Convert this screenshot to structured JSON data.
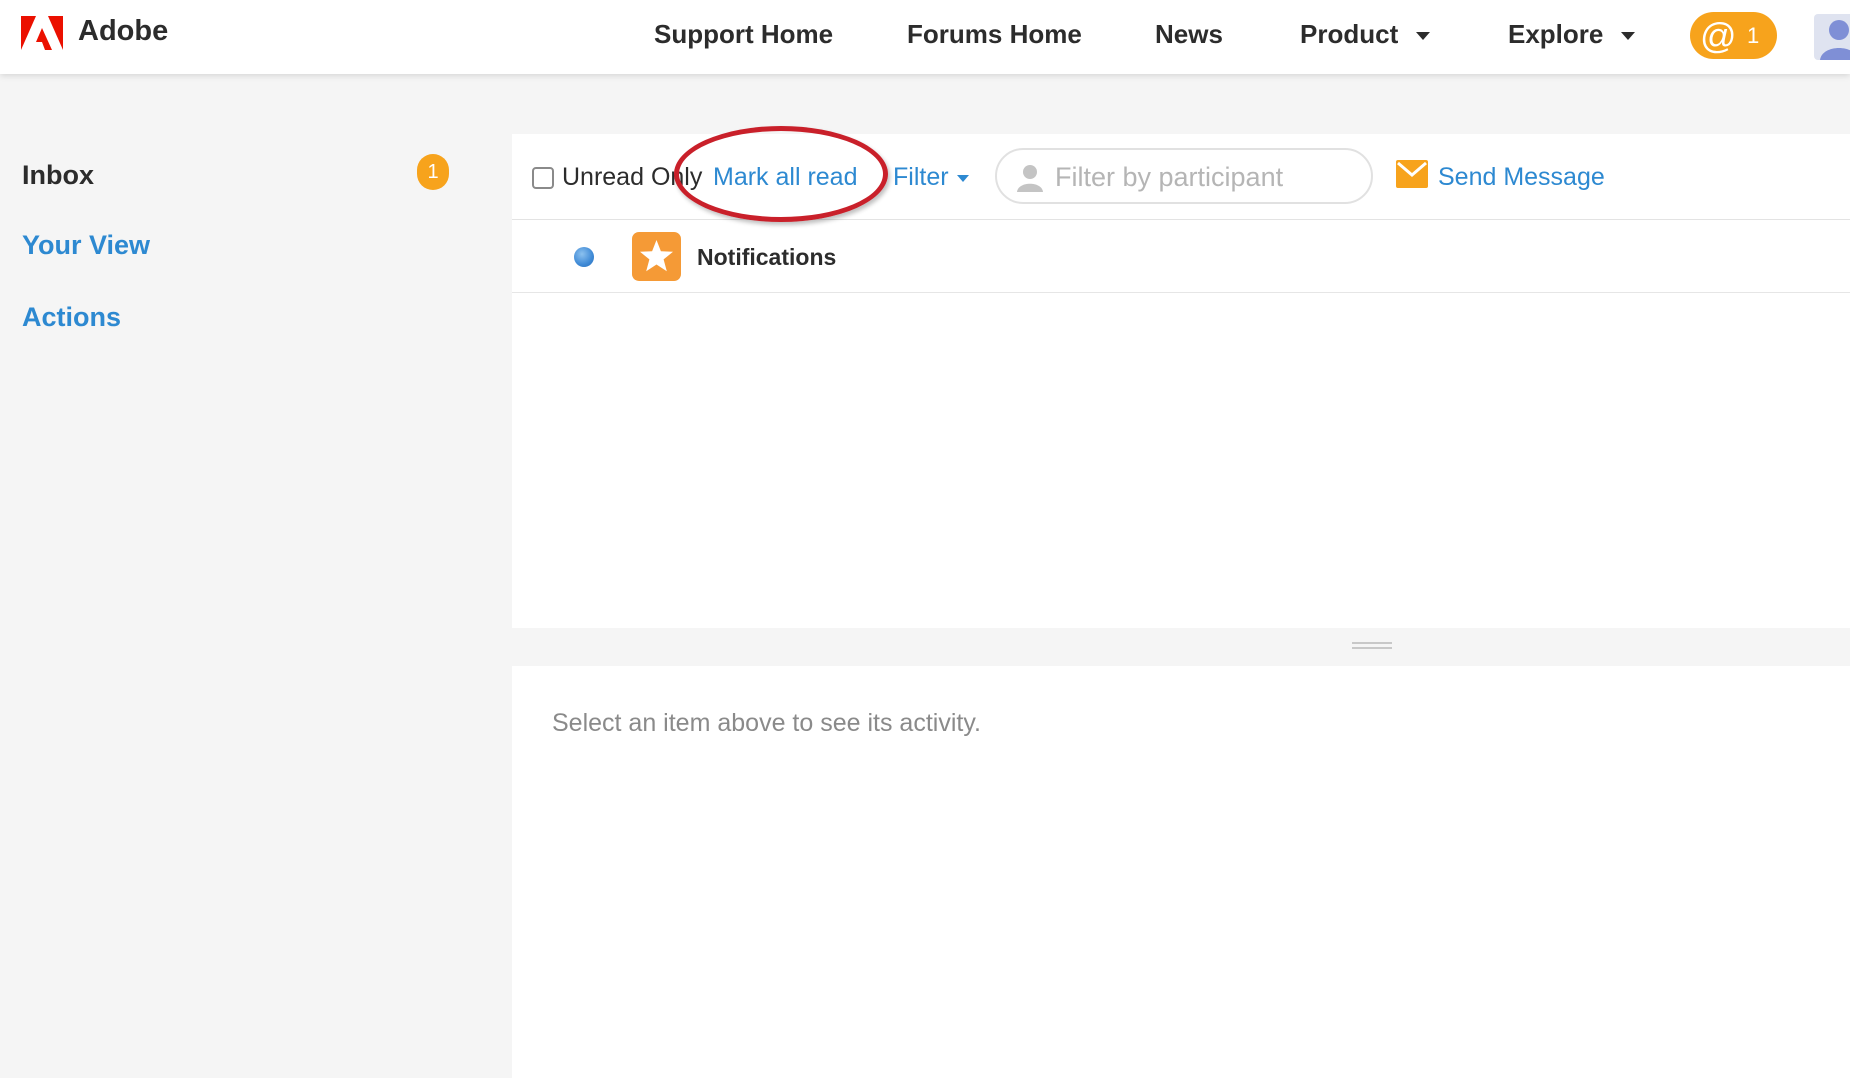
{
  "header": {
    "brand": "Adobe",
    "nav": [
      {
        "label": "Support Home"
      },
      {
        "label": "Forums Home"
      },
      {
        "label": "News"
      },
      {
        "label": "Product"
      },
      {
        "label": "Explore"
      }
    ],
    "mentions": {
      "symbol": "@",
      "count": "1"
    }
  },
  "sidebar": {
    "inbox": {
      "label": "Inbox",
      "badge": "1"
    },
    "items": [
      {
        "label": "Your View"
      },
      {
        "label": "Actions"
      }
    ]
  },
  "toolbar": {
    "unread_only_label": "Unread Only",
    "mark_all_read": "Mark all read",
    "filter": "Filter",
    "participant_placeholder": "Filter by participant",
    "send_message": "Send Message"
  },
  "list": {
    "rows": [
      {
        "title": "Notifications"
      }
    ]
  },
  "detail": {
    "hint": "Select an item above to see its activity."
  },
  "colors": {
    "accent": "#2d89d1",
    "badge": "#f7a31c",
    "annotation": "#c9202a",
    "adobe_red": "#eb1000"
  }
}
